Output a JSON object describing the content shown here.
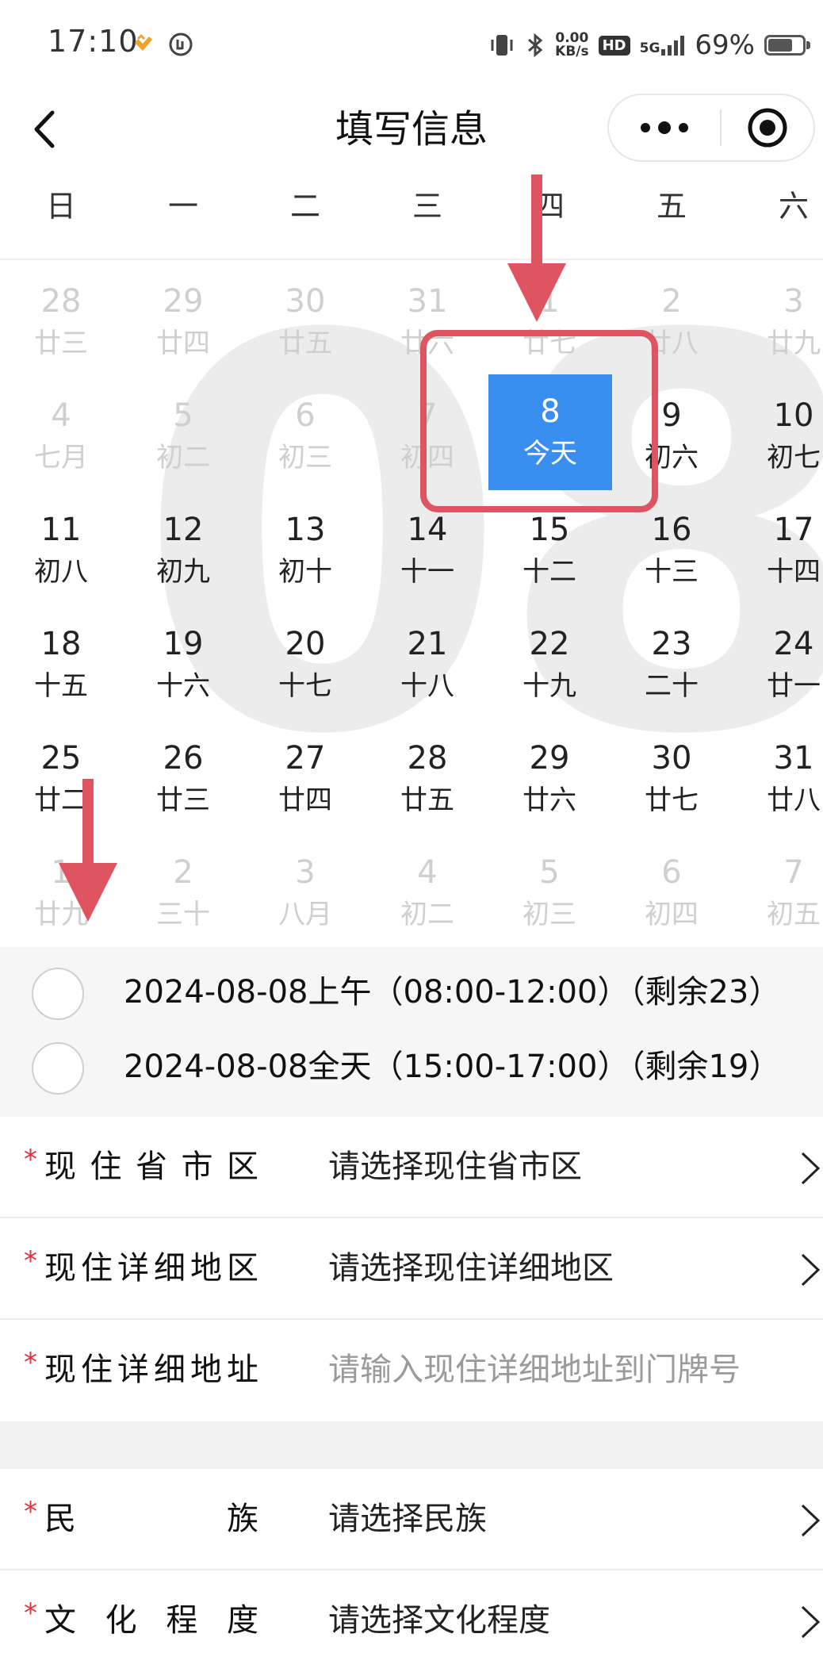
{
  "status_bar": {
    "time": "17:10",
    "net_speed_value": "0.00",
    "net_speed_unit": "KB/s",
    "hd_label": "HD",
    "signal_label": "5G",
    "battery_percent": "69%",
    "battery_level": 0.69,
    "icons": [
      "heart-badge-icon",
      "app-badge-icon",
      "vibrate-icon",
      "bluetooth-icon",
      "signal-icon",
      "battery-icon"
    ]
  },
  "nav": {
    "title": "填写信息",
    "icons": [
      "back-icon",
      "more-icon",
      "close-target-icon"
    ]
  },
  "calendar": {
    "weekdays": [
      "日",
      "一",
      "二",
      "三",
      "四",
      "五",
      "六"
    ],
    "watermark": "08",
    "weeks": [
      [
        {
          "d": "28",
          "l": "廿三",
          "m": true
        },
        {
          "d": "29",
          "l": "廿四",
          "m": true
        },
        {
          "d": "30",
          "l": "廿五",
          "m": true
        },
        {
          "d": "31",
          "l": "廿六",
          "m": true
        },
        {
          "d": "1",
          "l": "廿七",
          "m": true
        },
        {
          "d": "2",
          "l": "廿八",
          "m": true
        },
        {
          "d": "3",
          "l": "廿九",
          "m": true
        }
      ],
      [
        {
          "d": "4",
          "l": "七月",
          "m": true
        },
        {
          "d": "5",
          "l": "初二",
          "m": true
        },
        {
          "d": "6",
          "l": "初三",
          "m": true
        },
        {
          "d": "7",
          "l": "初四",
          "m": true
        },
        {
          "d": "8",
          "l": "今天",
          "m": false,
          "sel": true
        },
        {
          "d": "9",
          "l": "初六",
          "m": false
        },
        {
          "d": "10",
          "l": "初七",
          "m": false
        }
      ],
      [
        {
          "d": "11",
          "l": "初八",
          "m": false
        },
        {
          "d": "12",
          "l": "初九",
          "m": false
        },
        {
          "d": "13",
          "l": "初十",
          "m": false
        },
        {
          "d": "14",
          "l": "十一",
          "m": false
        },
        {
          "d": "15",
          "l": "十二",
          "m": false
        },
        {
          "d": "16",
          "l": "十三",
          "m": false
        },
        {
          "d": "17",
          "l": "十四",
          "m": false
        }
      ],
      [
        {
          "d": "18",
          "l": "十五",
          "m": false
        },
        {
          "d": "19",
          "l": "十六",
          "m": false
        },
        {
          "d": "20",
          "l": "十七",
          "m": false
        },
        {
          "d": "21",
          "l": "十八",
          "m": false
        },
        {
          "d": "22",
          "l": "十九",
          "m": false
        },
        {
          "d": "23",
          "l": "二十",
          "m": false
        },
        {
          "d": "24",
          "l": "廿一",
          "m": false
        }
      ],
      [
        {
          "d": "25",
          "l": "廿二",
          "m": false
        },
        {
          "d": "26",
          "l": "廿三",
          "m": false
        },
        {
          "d": "27",
          "l": "廿四",
          "m": false
        },
        {
          "d": "28",
          "l": "廿五",
          "m": false
        },
        {
          "d": "29",
          "l": "廿六",
          "m": false
        },
        {
          "d": "30",
          "l": "廿七",
          "m": false
        },
        {
          "d": "31",
          "l": "廿八",
          "m": false
        }
      ],
      [
        {
          "d": "1",
          "l": "廿九",
          "m": true
        },
        {
          "d": "2",
          "l": "三十",
          "m": true
        },
        {
          "d": "3",
          "l": "八月",
          "m": true
        },
        {
          "d": "4",
          "l": "初二",
          "m": true
        },
        {
          "d": "5",
          "l": "初三",
          "m": true
        },
        {
          "d": "6",
          "l": "初四",
          "m": true
        },
        {
          "d": "7",
          "l": "初五",
          "m": true
        }
      ]
    ]
  },
  "slots": [
    {
      "text": "2024-08-08上午（08:00-12:00）（剩余23）"
    },
    {
      "text": "2024-08-08全天（15:00-17:00）（剩余19）"
    }
  ],
  "form": [
    {
      "label": "现住省市区",
      "value": "请选择现住省市区",
      "placeholder": false,
      "chevron": true
    },
    {
      "label": "现住详细地区",
      "value": "请选择现住详细地区",
      "placeholder": false,
      "chevron": true
    },
    {
      "label": "现住详细地址",
      "value": "请输入现住详细地址到门牌号",
      "placeholder": true,
      "chevron": false
    },
    {
      "label": "民族",
      "value": "请选择民族",
      "placeholder": false,
      "chevron": true
    },
    {
      "label": "文化程度",
      "value": "请选择文化程度",
      "placeholder": false,
      "chevron": true
    }
  ],
  "required_mark": "*",
  "colors": {
    "accent": "#3a8ef0",
    "annotation": "#de5461",
    "required": "#e0323b",
    "muted_text": "#cfcfcf",
    "section_bg": "#f6f6f6"
  }
}
